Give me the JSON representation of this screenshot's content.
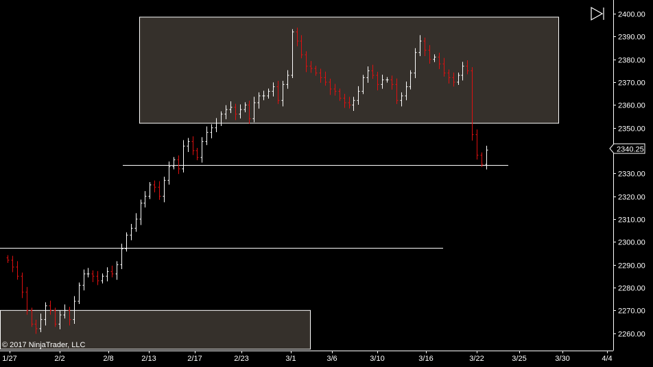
{
  "chart_data": {
    "type": "bar",
    "title": "",
    "xlabel": "",
    "ylabel": "",
    "ylim": [
      2253,
      2403
    ],
    "y_ticks": [
      "2260.00",
      "2270.00",
      "2280.00",
      "2290.00",
      "2300.00",
      "2310.00",
      "2320.00",
      "2330.00",
      "2340.00",
      "2350.00",
      "2360.00",
      "2370.00",
      "2380.00",
      "2390.00",
      "2400.00"
    ],
    "x_ticks": [
      "1/27",
      "2/2",
      "2/8",
      "2/13",
      "2/17",
      "2/23",
      "3/1",
      "3/6",
      "3/10",
      "3/16",
      "3/22",
      "3/25",
      "3/30",
      "4/4"
    ],
    "last_price": "2340.25",
    "copyright": "© 2017 NinjaTrader, LLC",
    "colors": {
      "background": "#000000",
      "up_bar": "#ffffff",
      "down_bar": "#e01010",
      "zone_fill": "#35302b",
      "zone_stroke": "#ffffff",
      "line": "#ffffff"
    },
    "zones": [
      {
        "from": "2/13",
        "to": "3/22",
        "low": 2352,
        "high": 2398.5
      },
      {
        "from": "1/27",
        "to": "3/3",
        "low": 2253,
        "high": 2270
      }
    ],
    "horizontal_lines": [
      {
        "price": 2333.8,
        "from": "2/10",
        "to": "3/24"
      },
      {
        "price": 2297.5,
        "from": "1/27",
        "to": "3/18"
      }
    ],
    "series": [
      {
        "values": [
          2292,
          2289,
          2285,
          2278,
          2270,
          2264,
          2262,
          2266,
          2272,
          2270,
          2264,
          2268,
          2270,
          2266,
          2274,
          2281,
          2286,
          2286,
          2285,
          2283,
          2285,
          2287,
          2286,
          2290,
          2297,
          2303,
          2306,
          2310,
          2317,
          2320,
          2325,
          2324,
          2320,
          2327,
          2333,
          2336,
          2332,
          2342,
          2344,
          2340,
          2337,
          2344,
          2348,
          2350,
          2352,
          2356,
          2358,
          2359,
          2356,
          2358,
          2360,
          2354,
          2361,
          2364,
          2364,
          2366,
          2368,
          2362,
          2369,
          2373,
          2392,
          2388,
          2382,
          2377,
          2376,
          2374,
          2372,
          2370,
          2367,
          2366,
          2363,
          2361,
          2360,
          2362,
          2366,
          2372,
          2375,
          2373,
          2369,
          2371,
          2371,
          2369,
          2362,
          2364,
          2368,
          2374,
          2383,
          2388,
          2384,
          2380,
          2381,
          2378,
          2374,
          2372,
          2370,
          2373,
          2377,
          2375,
          2347,
          2338,
          2334,
          2340.25
        ]
      }
    ]
  },
  "ui": {
    "toggle_icon": "play-end-icon"
  }
}
